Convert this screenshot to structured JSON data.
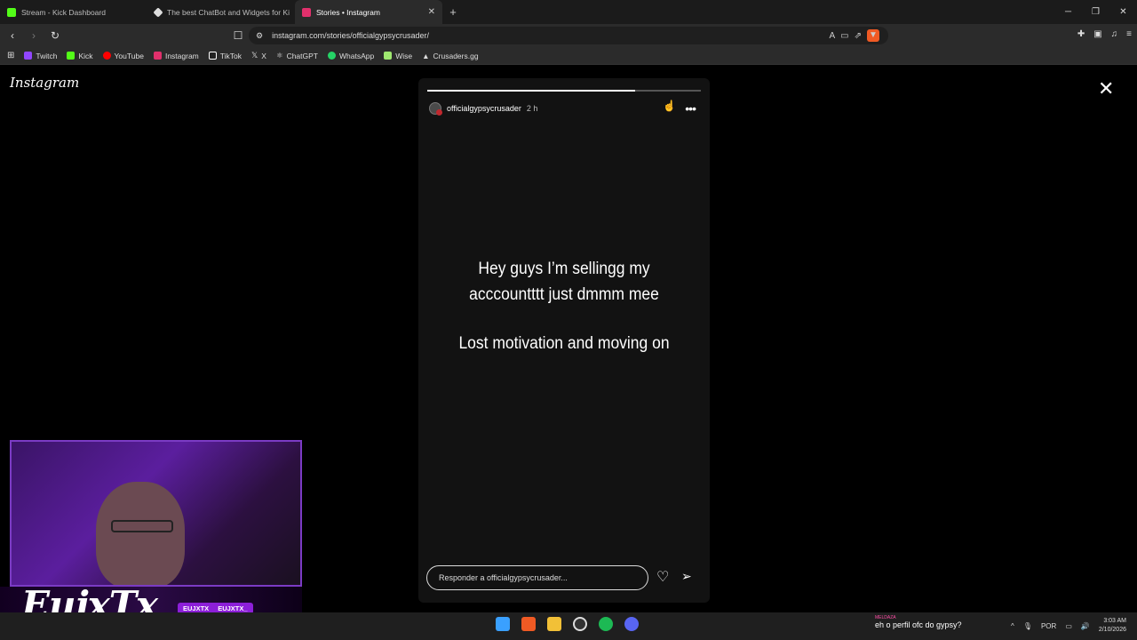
{
  "tabs": [
    {
      "label": "Stream - Kick Dashboard",
      "color": "#53fc18"
    },
    {
      "label": "The best ChatBot and Widgets for Ki",
      "color": "#dddddd"
    },
    {
      "label": "Stories • Instagram",
      "color": "#e1306c"
    }
  ],
  "address": {
    "url": "instagram.com/stories/officialgypsycrusader/"
  },
  "bookmarks": [
    {
      "label": "Twitch",
      "color": "#9146ff"
    },
    {
      "label": "Kick",
      "color": "#53fc18"
    },
    {
      "label": "YouTube",
      "color": "#ff0000"
    },
    {
      "label": "Instagram",
      "color": "#e1306c"
    },
    {
      "label": "TikTok",
      "color": "#ffffff"
    },
    {
      "label": "X",
      "color": "#ffffff"
    },
    {
      "label": "ChatGPT",
      "color": "#cccccc"
    },
    {
      "label": "WhatsApp",
      "color": "#25d366"
    },
    {
      "label": "Wise",
      "color": "#9fe870"
    },
    {
      "label": "Crusaders.gg",
      "color": "#ffffff"
    }
  ],
  "instagram": {
    "logo": "Instagram"
  },
  "story": {
    "username": "officialgypsycrusader",
    "time": "2 h",
    "progress": 0.76,
    "line1": "Hey guys I’m sellingg my",
    "line2": "acccountttt just dmmm mee",
    "line3": "Lost motivation and moving on",
    "reply_placeholder": "Responder a officialgypsycrusader..."
  },
  "overlay": {
    "name": "EujxTx",
    "tag1": "EUJXTX",
    "tag2": "EUJXTX_"
  },
  "taskbar": {
    "notif_label": "MELDAZA",
    "notif_text": "eh o perfil ofc do gypsy?",
    "lang": "POR",
    "time": "3:03 AM",
    "date": "2/10/2026"
  }
}
